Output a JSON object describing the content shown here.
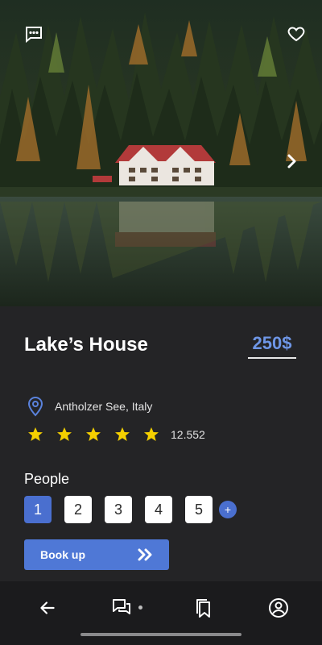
{
  "hero": {
    "photo": "lake-house-photo",
    "actions": [
      "chat-icon",
      "heart-icon",
      "chevron-right-icon"
    ]
  },
  "listing": {
    "title": "Lake’s House",
    "price": "250$",
    "location": "Antholzer See, Italy",
    "rating_stars": 5,
    "rating_count": "12.552"
  },
  "people": {
    "label": "People",
    "options": [
      "1",
      "2",
      "3",
      "4",
      "5"
    ],
    "selected": "1",
    "add_label": "+"
  },
  "book_button": {
    "label": "Book up"
  },
  "bottom_nav": {
    "items": [
      "arrow-left-icon",
      "chat-icon",
      "bookmark-icon",
      "user-icon"
    ]
  },
  "colors": {
    "accent": "#4f78d6",
    "price": "#6e96e6",
    "star": "#f5d000",
    "background": "#242426"
  }
}
